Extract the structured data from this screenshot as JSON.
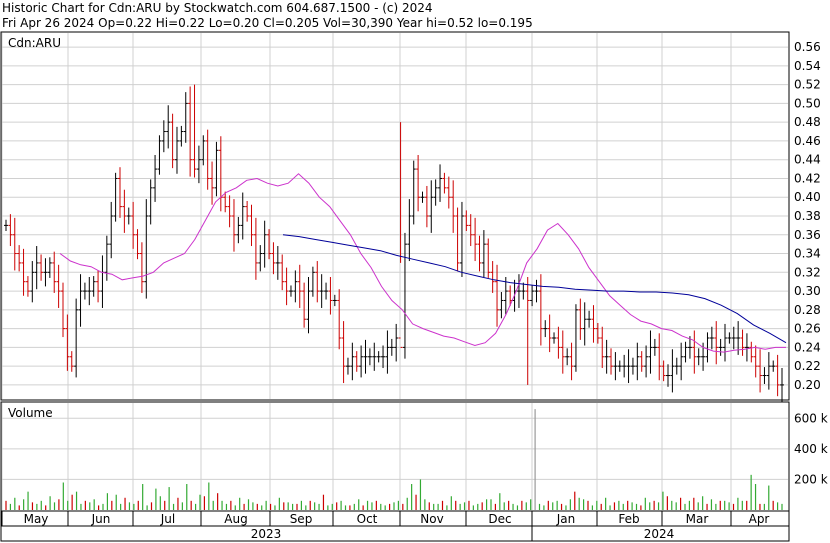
{
  "header": {
    "line1": "Historic Chart for Cdn:ARU by Stockwatch.com 604.687.1500 - (c) 2024",
    "line2": "Fri Apr 26 2024   Op=0.22  Hi=0.22  Lo=0.20  Cl=0.205  Vol=30,390  Year hi=0.52  lo=0.195"
  },
  "colors": {
    "up": "#000000",
    "down": "#cc0000",
    "ma_short": "#cc33cc",
    "ma_long": "#000099",
    "vol_up": "#33aa33",
    "vol_down": "#cc0000",
    "vol_special": "#999999",
    "grid": "#d0d0d0"
  },
  "chart_data": [
    {
      "type": "line",
      "subtype": "ohlc",
      "symbol_label": "Cdn:ARU",
      "ylim": [
        0.185,
        0.575
      ],
      "y_ticks": [
        "0.56",
        "0.54",
        "0.52",
        "0.50",
        "0.48",
        "0.46",
        "0.44",
        "0.42",
        "0.40",
        "0.38",
        "0.36",
        "0.34",
        "0.32",
        "0.30",
        "0.28",
        "0.26",
        "0.24",
        "0.22",
        "0.20"
      ],
      "x_months": [
        "May",
        "Jun",
        "Jul",
        "Aug",
        "Sep",
        "Oct",
        "Nov",
        "Dec",
        "Jan",
        "Feb",
        "Mar",
        "Apr"
      ],
      "x_years": [
        "2023",
        "2024"
      ],
      "grid": true,
      "series": [
        {
          "style": "ohlc",
          "close": [
            0.37,
            0.36,
            0.34,
            0.33,
            0.31,
            0.3,
            0.32,
            0.33,
            0.32,
            0.32,
            0.33,
            0.31,
            0.3,
            0.26,
            0.23,
            0.22,
            0.28,
            0.3,
            0.3,
            0.3,
            0.31,
            0.3,
            0.32,
            0.35,
            0.38,
            0.42,
            0.39,
            0.38,
            0.38,
            0.36,
            0.34,
            0.31,
            0.38,
            0.41,
            0.43,
            0.46,
            0.47,
            0.48,
            0.44,
            0.46,
            0.47,
            0.5,
            0.44,
            0.43,
            0.44,
            0.46,
            0.42,
            0.41,
            0.45,
            0.4,
            0.39,
            0.38,
            0.36,
            0.37,
            0.39,
            0.38,
            0.36,
            0.33,
            0.34,
            0.36,
            0.34,
            0.33,
            0.33,
            0.31,
            0.3,
            0.3,
            0.31,
            0.3,
            0.27,
            0.3,
            0.32,
            0.3,
            0.3,
            0.3,
            0.29,
            0.29,
            0.25,
            0.22,
            0.22,
            0.23,
            0.22,
            0.23,
            0.23,
            0.23,
            0.23,
            0.23,
            0.23,
            0.24,
            0.24,
            0.25,
            0.24,
            0.35,
            0.38,
            0.43,
            0.4,
            0.4,
            0.38,
            0.4,
            0.41,
            0.42,
            0.41,
            0.4,
            0.38,
            0.33,
            0.38,
            0.37,
            0.36,
            0.35,
            0.33,
            0.35,
            0.32,
            0.31,
            0.28,
            0.29,
            0.3,
            0.29,
            0.3,
            0.3,
            0.3,
            0.29,
            0.3,
            0.3,
            0.26,
            0.26,
            0.25,
            0.25,
            0.24,
            0.23,
            0.23,
            0.22,
            0.28,
            0.26,
            0.27,
            0.27,
            0.26,
            0.25,
            0.23,
            0.23,
            0.22,
            0.22,
            0.22,
            0.22,
            0.22,
            0.22,
            0.23,
            0.22,
            0.23,
            0.24,
            0.24,
            0.22,
            0.21,
            0.21,
            0.22,
            0.22,
            0.23,
            0.24,
            0.24,
            0.23,
            0.23,
            0.23,
            0.25,
            0.25,
            0.24,
            0.24,
            0.25,
            0.25,
            0.25,
            0.25,
            0.24,
            0.24,
            0.23,
            0.22,
            0.21,
            0.21,
            0.22,
            0.22,
            0.2,
            0.2
          ]
        },
        {
          "style": "line",
          "values": [
            0.34,
            0.332,
            0.328,
            0.326,
            0.32,
            0.318,
            0.312,
            0.314,
            0.316,
            0.32,
            0.33,
            0.335,
            0.34,
            0.355,
            0.375,
            0.395,
            0.405,
            0.41,
            0.418,
            0.42,
            0.415,
            0.412,
            0.415,
            0.425,
            0.415,
            0.4,
            0.39,
            0.375,
            0.36,
            0.34,
            0.325,
            0.305,
            0.29,
            0.28,
            0.265,
            0.26,
            0.256,
            0.252,
            0.25,
            0.246,
            0.242,
            0.245,
            0.255,
            0.275,
            0.3,
            0.33,
            0.345,
            0.365,
            0.372,
            0.36,
            0.345,
            0.325,
            0.31,
            0.295,
            0.285,
            0.275,
            0.268,
            0.265,
            0.26,
            0.258,
            0.252,
            0.248,
            0.24,
            0.236,
            0.235,
            0.237,
            0.238,
            0.24,
            0.238,
            0.24,
            0.24
          ]
        },
        {
          "style": "line",
          "values": [
            0.36,
            0.358,
            0.355,
            0.352,
            0.349,
            0.346,
            0.343,
            0.338,
            0.334,
            0.33,
            0.326,
            0.32,
            0.316,
            0.312,
            0.309,
            0.307,
            0.305,
            0.304,
            0.302,
            0.301,
            0.3,
            0.3,
            0.299,
            0.299,
            0.298,
            0.296,
            0.292,
            0.285,
            0.276,
            0.264,
            0.255,
            0.245
          ]
        }
      ]
    },
    {
      "type": "bar",
      "title": "Volume",
      "y_ticks": [
        "600 k",
        "400 k",
        "200 k"
      ],
      "ylim": [
        0,
        700000
      ],
      "series": [
        {
          "name": "",
          "values": [
            60,
            40,
            80,
            30,
            70,
            120,
            50,
            40,
            60,
            30,
            90,
            50,
            70,
            180,
            60,
            100,
            120,
            40,
            60,
            50,
            70,
            30,
            40,
            110,
            60,
            100,
            40,
            80,
            50,
            40,
            60,
            170,
            30,
            50,
            140,
            90,
            60,
            150,
            40,
            80,
            50,
            170,
            60,
            40,
            100,
            90,
            180,
            60,
            110,
            60,
            40,
            60,
            30,
            80,
            40,
            70,
            50,
            40,
            30,
            60,
            40,
            30,
            80,
            50,
            50,
            40,
            40,
            60,
            30,
            60,
            50,
            40,
            100,
            30,
            40,
            50,
            60,
            30,
            30,
            40,
            70,
            30,
            60,
            50,
            60,
            40,
            30,
            40,
            50,
            60,
            40,
            80,
            170,
            100,
            200,
            70,
            50,
            40,
            40,
            60,
            30,
            90,
            60,
            40,
            50,
            60,
            30,
            40,
            50,
            70,
            70,
            40,
            110,
            50,
            60,
            40,
            30,
            60,
            50,
            70,
            660,
            40,
            30,
            60,
            50,
            60,
            40,
            30,
            70,
            120,
            80,
            70,
            60,
            30,
            60,
            40,
            80,
            30,
            50,
            60,
            40,
            60,
            50,
            40,
            30,
            80,
            50,
            60,
            50,
            120,
            90,
            60,
            50,
            80,
            40,
            60,
            80,
            50,
            90,
            40,
            70,
            40,
            60,
            60,
            50,
            40,
            80,
            60,
            60,
            230,
            170,
            40,
            40,
            160,
            60,
            50,
            40
          ]
        }
      ]
    }
  ]
}
